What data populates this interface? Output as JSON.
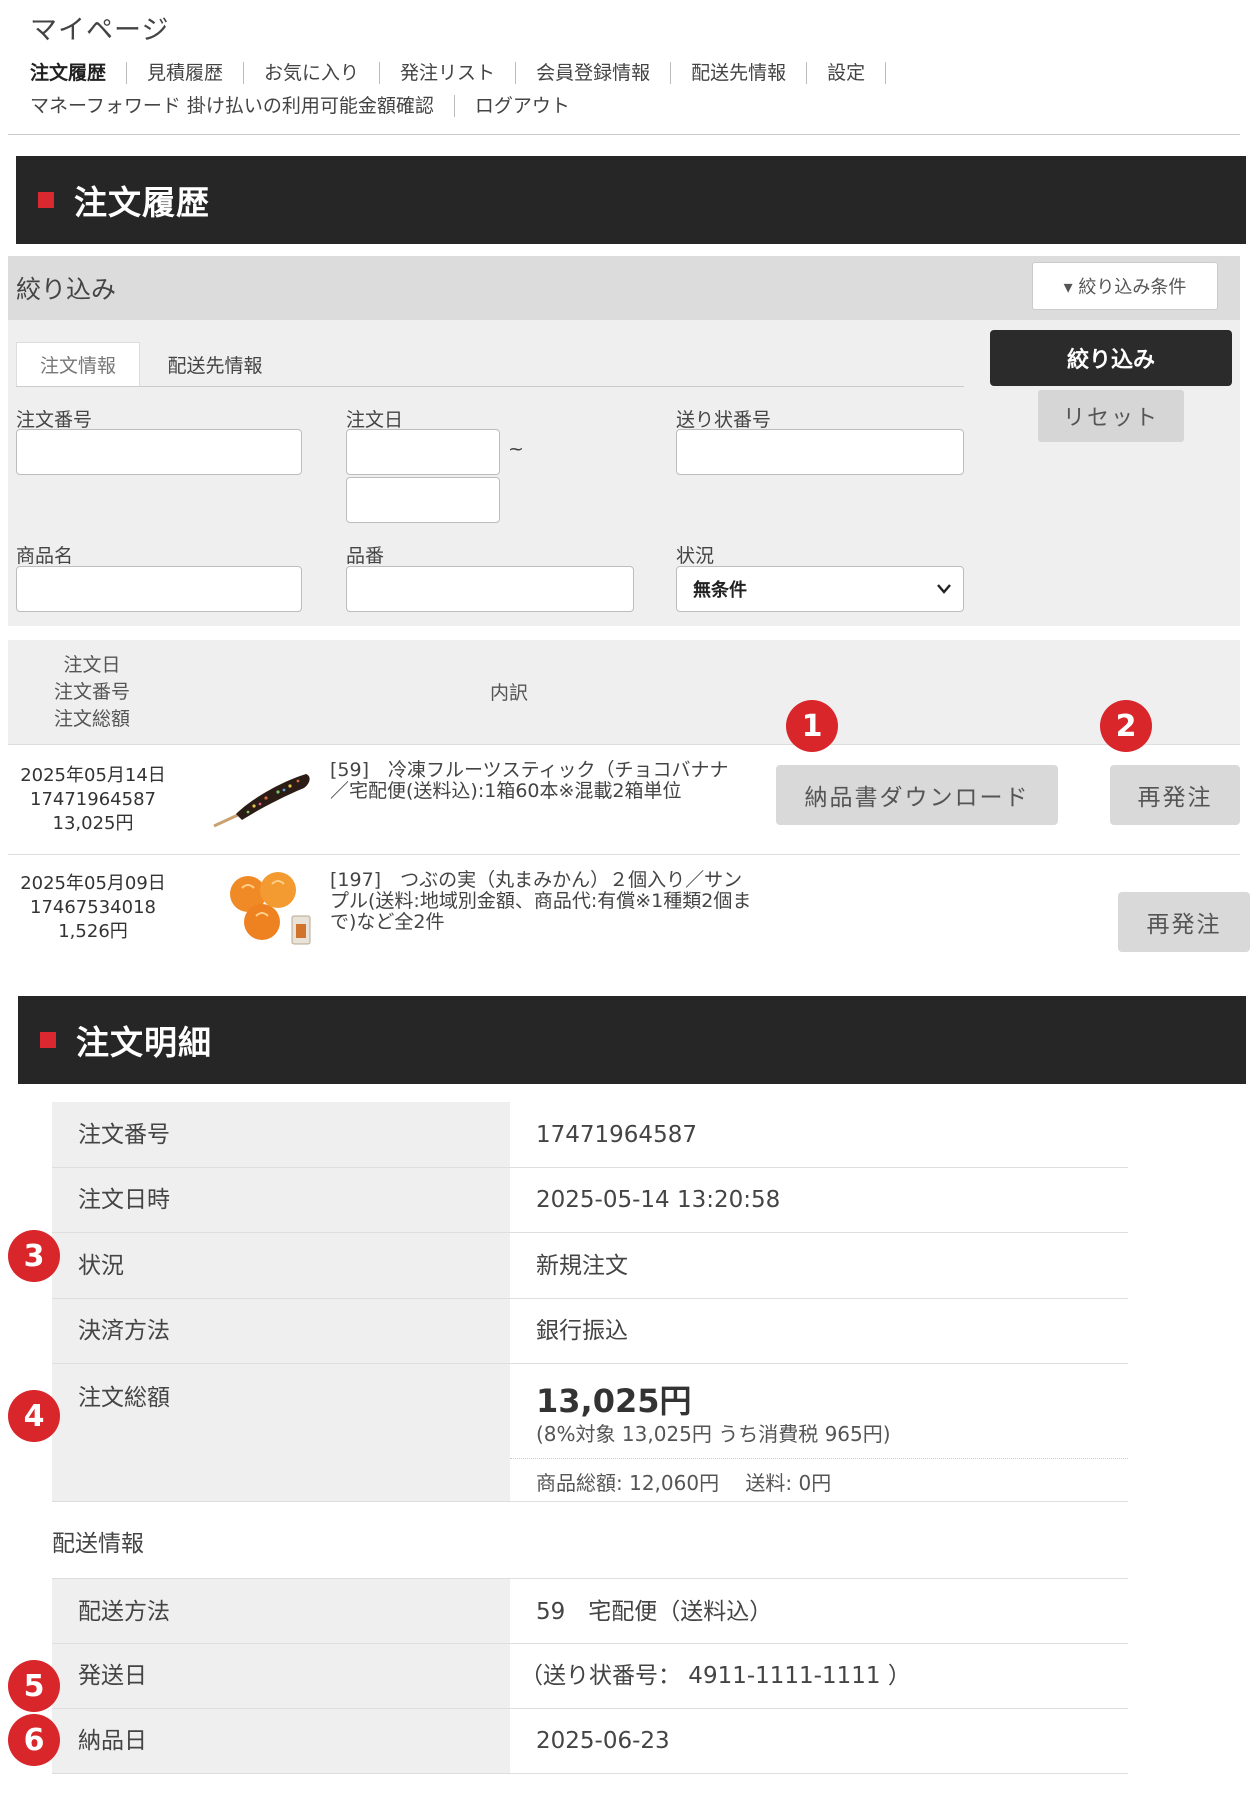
{
  "page_title": "マイページ",
  "nav": {
    "row1": [
      "注文履歴",
      "見積履歴",
      "お気に入り",
      "発注リスト",
      "会員登録情報",
      "配送先情報",
      "設定"
    ],
    "row2": [
      "マネーフォワード 掛け払いの利用可能金額確認",
      "ログアウト"
    ],
    "active": "注文履歴"
  },
  "order_history": {
    "header": "注文履歴",
    "filter": {
      "title": "絞り込み",
      "conditions_button": "▾ 絞り込み条件",
      "tabs": [
        "注文情報",
        "配送先情報"
      ],
      "submit_label": "絞り込み",
      "reset_label": "リセット",
      "fields": {
        "order_number": {
          "label": "注文番号",
          "value": ""
        },
        "order_date": {
          "label": "注文日",
          "from": "",
          "to": "",
          "separator": "~"
        },
        "tracking_number": {
          "label": "送り状番号",
          "value": ""
        },
        "product_name": {
          "label": "商品名",
          "value": ""
        },
        "product_code": {
          "label": "品番",
          "value": ""
        },
        "status": {
          "label": "状況",
          "selected": "無条件"
        }
      }
    },
    "table": {
      "col_left": [
        "注文日",
        "注文番号",
        "注文総額"
      ],
      "col_mid": "内訳"
    },
    "orders": [
      {
        "date": "2025年05月14日",
        "number": "17471964587",
        "total": "13,025円",
        "line1": "[59]　冷凍フルーツスティック（チョコバナナ",
        "line2": "／宅配便(送料込):1箱60本※混載2箱単位",
        "line3": "",
        "download_label": "納品書ダウンロード",
        "reorder_label": "再発注"
      },
      {
        "date": "2025年05月09日",
        "number": "17467534018",
        "total": "1,526円",
        "line1": "[197]　つぶの実（丸まみかん）２個入り／サン",
        "line2": "プル(送料:地域別金額、商品代:有償※1種類2個ま",
        "line3": "で)など全2件",
        "reorder_label": "再発注"
      }
    ]
  },
  "order_detail": {
    "header": "注文明細",
    "rows": [
      {
        "key": "注文番号",
        "value": "17471964587"
      },
      {
        "key": "注文日時",
        "value": "2025-05-14 13:20:58"
      },
      {
        "key": "状況",
        "value": "新規注文"
      },
      {
        "key": "決済方法",
        "value": "銀行振込"
      }
    ],
    "total": {
      "key": "注文総額",
      "amount": "13,025円",
      "tax_note": "(8%対象 13,025円 うち消費税 965円)",
      "breakdown": "商品総額: 12,060円　 送料: 0円"
    },
    "shipping_title": "配送情報",
    "shipping_rows": [
      {
        "key": "配送方法",
        "value": "59　宅配便（送料込）"
      },
      {
        "key": "発送日",
        "value": "（送り状番号： 4911-1111-1111 ）"
      },
      {
        "key": "納品日",
        "value": "2025-06-23"
      }
    ]
  },
  "badges": [
    "1",
    "2",
    "3",
    "4",
    "5",
    "6"
  ],
  "colors": {
    "accent_red": "#d9262b",
    "header_dark": "#262626"
  }
}
